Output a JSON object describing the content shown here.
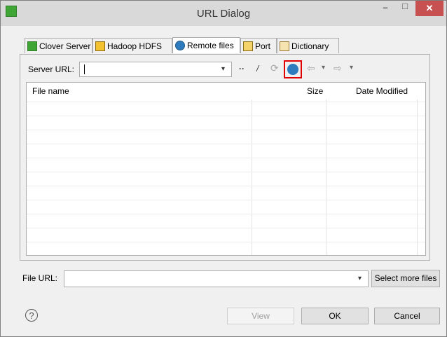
{
  "window": {
    "title": "URL Dialog",
    "minimize": "–",
    "maximize": "□",
    "close": "✕"
  },
  "tabs": [
    {
      "label": "Clover Server",
      "icon": "clover-icon"
    },
    {
      "label": "Hadoop HDFS",
      "icon": "hdfs-icon"
    },
    {
      "label": "Remote files",
      "icon": "globe-icon",
      "active": true
    },
    {
      "label": "Port",
      "icon": "port-icon"
    },
    {
      "label": "Dictionary",
      "icon": "dictionary-icon"
    }
  ],
  "server": {
    "label": "Server URL:",
    "value": ""
  },
  "toolbar": {
    "parent": "··",
    "root": "/",
    "refresh": "⟳",
    "back": "⇦",
    "back_menu": "▾",
    "forward": "⇨",
    "forward_menu": "▾"
  },
  "table": {
    "columns": [
      "File name",
      "Size",
      "Date Modified"
    ]
  },
  "file_url": {
    "label": "File URL:",
    "value": ""
  },
  "buttons": {
    "select_more": "Select more files",
    "view": "View",
    "ok": "OK",
    "cancel": "Cancel",
    "help": "?"
  }
}
